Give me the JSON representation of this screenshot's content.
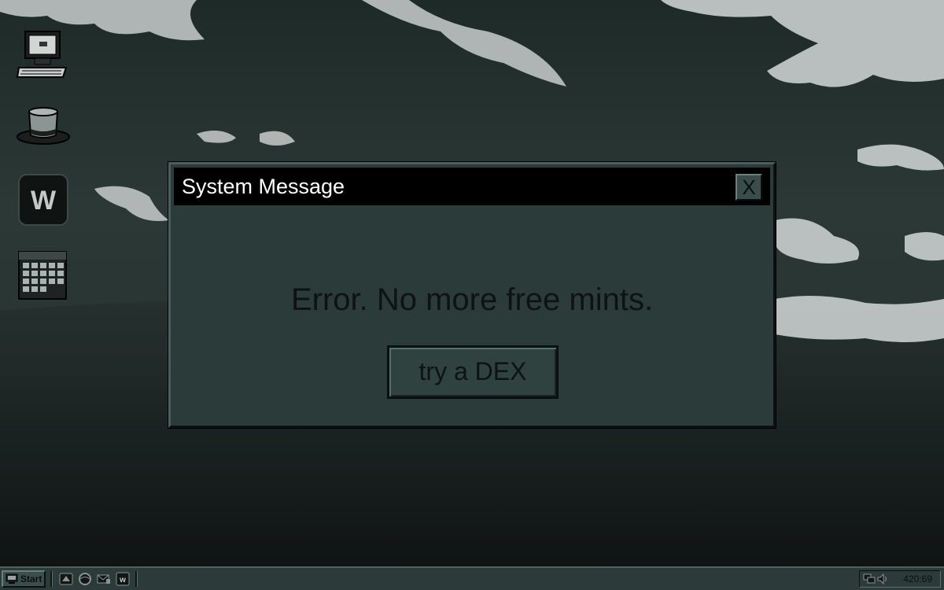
{
  "desktop": {
    "icons": [
      {
        "name": "my-computer-icon"
      },
      {
        "name": "top-hat-icon"
      },
      {
        "name": "w-app-icon",
        "glyph": "W"
      },
      {
        "name": "calendar-icon"
      }
    ]
  },
  "dialog": {
    "title": "System Message",
    "close_label": "X",
    "message": "Error. No more free mints.",
    "action_label": "try a DEX"
  },
  "taskbar": {
    "start_label": "Start",
    "quick_launch": [
      {
        "name": "quicklaunch-desktop-icon"
      },
      {
        "name": "quicklaunch-browser-icon"
      },
      {
        "name": "quicklaunch-mail-icon"
      },
      {
        "name": "quicklaunch-w-icon"
      }
    ],
    "tray": {
      "icons": [
        "network-icon",
        "volume-icon"
      ],
      "clock": "420:69"
    }
  },
  "colors": {
    "dialog_bg": "#2a3b39",
    "titlebar_bg": "#000000",
    "title_text": "#ffffff",
    "body_text": "#0e1312",
    "taskbar_bg": "#2c3b39"
  }
}
